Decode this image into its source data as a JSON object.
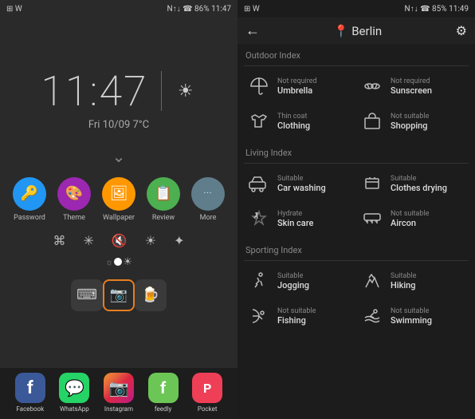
{
  "left": {
    "status_bar": {
      "left_icons": "⊞ W",
      "time": "11:47",
      "right_icons": "N↑↓ ☎ 86% 11:47"
    },
    "clock": "11:47",
    "date_temp": "Fri 10/09   7°C",
    "quick_actions": [
      {
        "id": "password",
        "label": "Password",
        "color": "#2196F3",
        "icon": "🔑"
      },
      {
        "id": "theme",
        "label": "Theme",
        "color": "#9C27B0",
        "icon": "🎨"
      },
      {
        "id": "wallpaper",
        "label": "Wallpaper",
        "color": "#FF9800",
        "icon": "🖼"
      },
      {
        "id": "review",
        "label": "Review",
        "color": "#4CAF50",
        "icon": "📋"
      },
      {
        "id": "more",
        "label": "More",
        "color": "#607D8B",
        "icon": "•••"
      }
    ],
    "bottom_icons": [
      {
        "id": "keyboard",
        "label": "",
        "icon": "⌨",
        "highlighted": false
      },
      {
        "id": "camera",
        "label": "",
        "icon": "📷",
        "highlighted": true
      },
      {
        "id": "beer",
        "label": "",
        "icon": "🍺",
        "highlighted": false
      }
    ],
    "apps": [
      {
        "id": "facebook",
        "label": "Facebook",
        "icon": "f",
        "bg": "#3b5998"
      },
      {
        "id": "whatsapp",
        "label": "WhatsApp",
        "icon": "💬",
        "bg": "#25D366"
      },
      {
        "id": "instagram",
        "label": "Instagram",
        "icon": "📷",
        "bg": "#C13584"
      },
      {
        "id": "feedly",
        "label": "feedly",
        "icon": "f",
        "bg": "#6CC655"
      },
      {
        "id": "pocket",
        "label": "Pocket",
        "icon": "P",
        "bg": "#EF3F56"
      }
    ]
  },
  "right": {
    "status_bar": {
      "left_icons": "⊞ W",
      "right_icons": "N↑↓ ☎ 85% 11:49"
    },
    "header": {
      "back_label": "←",
      "city_icon": "📍",
      "city": "Berlin",
      "settings_icon": "⚙"
    },
    "outdoor_index": {
      "title": "Outdoor Index",
      "items": [
        {
          "icon": "🔨",
          "status": "Not required",
          "name": "Umbrella"
        },
        {
          "icon": "🕶",
          "status": "Not required",
          "name": "Sunscreen"
        },
        {
          "icon": "👕",
          "status": "Thin coat",
          "name": "Clothing"
        },
        {
          "icon": "🛒",
          "status": "Not suitable",
          "name": "Shopping"
        }
      ]
    },
    "living_index": {
      "title": "Living Index",
      "items": [
        {
          "icon": "🚗",
          "status": "Suitable",
          "name": "Car washing"
        },
        {
          "icon": "👕",
          "status": "Suitable",
          "name": "Clothes drying"
        },
        {
          "icon": "💧",
          "status": "Hydrate",
          "name": "Skin care"
        },
        {
          "icon": "❄",
          "status": "Not suitable",
          "name": "Aircon"
        }
      ]
    },
    "sporting_index": {
      "title": "Sporting Index",
      "items": [
        {
          "icon": "🏃",
          "status": "Suitable",
          "name": "Jogging"
        },
        {
          "icon": "🥾",
          "status": "Suitable",
          "name": "Hiking"
        },
        {
          "icon": "🎣",
          "status": "Not suitable",
          "name": "Fishing"
        },
        {
          "icon": "🏊",
          "status": "Not suitable",
          "name": "Swimming"
        }
      ]
    }
  }
}
